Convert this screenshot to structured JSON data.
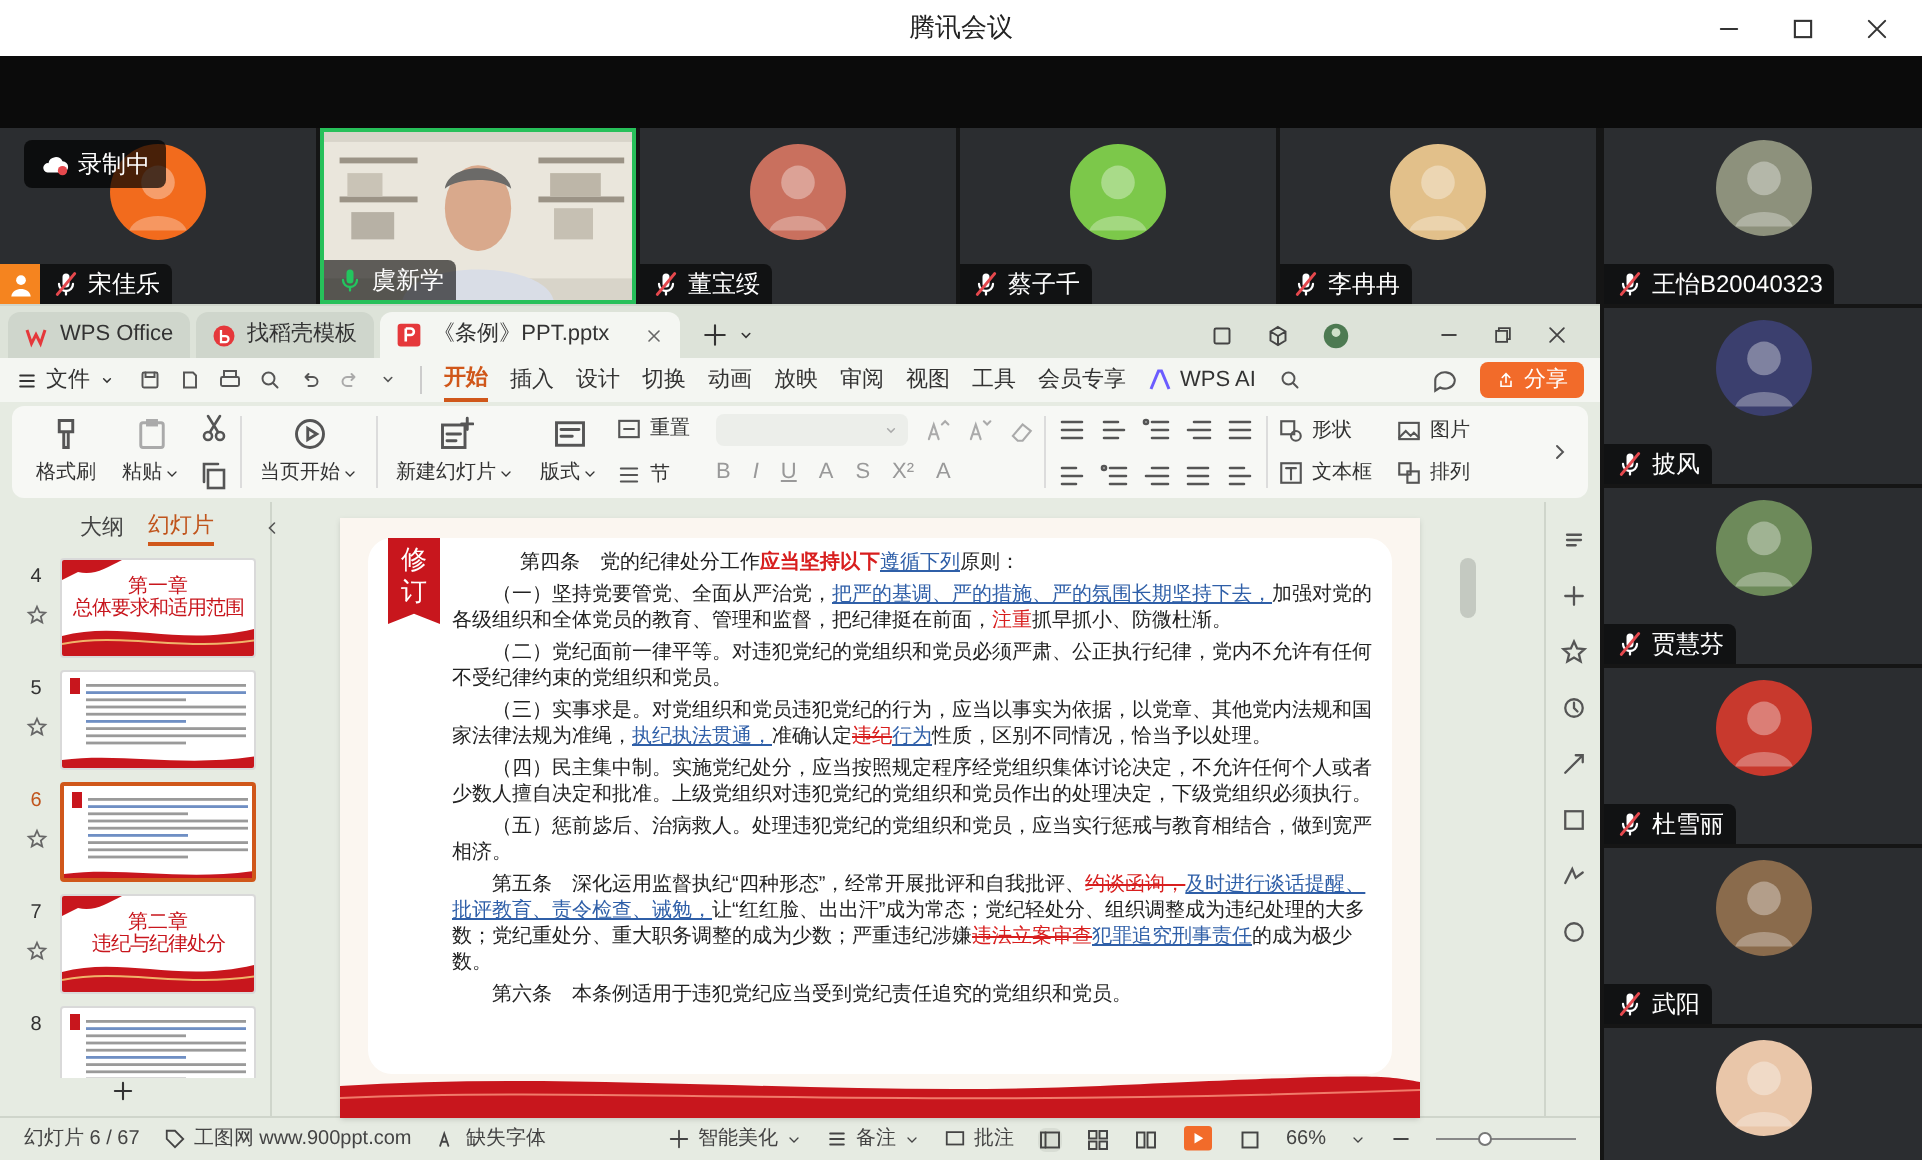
{
  "app_title": "腾讯会议",
  "recording": {
    "label": "录制中"
  },
  "top_participants": [
    {
      "name": "宋佳乐",
      "kind": "avatar",
      "color": "#f26b1d",
      "muted": true,
      "host": true,
      "speaking": false
    },
    {
      "name": "虞新学",
      "kind": "video",
      "muted": false,
      "host": false,
      "speaking": true
    },
    {
      "name": "董宝绥",
      "kind": "avatar",
      "color": "#c9705e",
      "muted": true,
      "host": false,
      "speaking": false
    },
    {
      "name": "蔡子千",
      "kind": "avatar",
      "color": "#7cc84a",
      "muted": true,
      "host": false,
      "speaking": false
    },
    {
      "name": "李冉冉",
      "kind": "avatar",
      "color": "#e2c08a",
      "muted": true,
      "host": false,
      "speaking": false
    }
  ],
  "side_participants": [
    {
      "name": "王怡B20040323",
      "color": "#8d917c",
      "muted": true
    },
    {
      "name": "披风",
      "color": "#3b3f6e",
      "muted": true
    },
    {
      "name": "贾慧芬",
      "color": "#6d8a5a",
      "muted": true
    },
    {
      "name": "杜雪丽",
      "color": "#c8392d",
      "muted": true
    },
    {
      "name": "武阳",
      "color": "#8a6b4c",
      "muted": true
    },
    {
      "color": "#e9c6a9"
    }
  ],
  "wps": {
    "tabs": [
      {
        "label": "WPS Office",
        "kind": "home",
        "selected": false
      },
      {
        "label": "找稻壳模板",
        "kind": "template",
        "selected": false
      },
      {
        "label": "《条例》PPT.pptx",
        "kind": "doc",
        "selected": true
      }
    ],
    "menu": {
      "file": "文件",
      "items": [
        {
          "label": "开始",
          "selected": true
        },
        {
          "label": "插入",
          "selected": false
        },
        {
          "label": "设计",
          "selected": false
        },
        {
          "label": "切换",
          "selected": false
        },
        {
          "label": "动画",
          "selected": false
        },
        {
          "label": "放映",
          "selected": false
        },
        {
          "label": "审阅",
          "selected": false
        },
        {
          "label": "视图",
          "selected": false
        },
        {
          "label": "工具",
          "selected": false
        },
        {
          "label": "会员专享",
          "selected": false
        }
      ],
      "ai": "WPS AI",
      "share": "分享"
    },
    "ribbon": {
      "format_painter": "格式刷",
      "paste": "粘贴",
      "start_show": "当页开始",
      "new_slide": "新建幻灯片",
      "layout": "版式",
      "reset": "重置",
      "section": "节",
      "format_glyphs": [
        "B",
        "I",
        "U",
        "A",
        "S",
        "X²",
        "A"
      ],
      "shape": "形状",
      "picture": "图片",
      "textbox": "文本框",
      "arrange": "排列"
    },
    "panel": {
      "tabs": [
        {
          "label": "大纲",
          "selected": false
        },
        {
          "label": "幻灯片",
          "selected": true
        }
      ],
      "slides": [
        {
          "number": "4",
          "kind": "title",
          "title": "第一章",
          "subtitle": "总体要求和适用范围",
          "star": true,
          "selected": false
        },
        {
          "number": "5",
          "kind": "text",
          "star": true,
          "selected": false
        },
        {
          "number": "6",
          "kind": "text",
          "star": true,
          "selected": true
        },
        {
          "number": "7",
          "kind": "title",
          "title": "第二章",
          "subtitle": "违纪与纪律处分",
          "star": true,
          "selected": false
        },
        {
          "number": "8",
          "kind": "text",
          "selected": false
        }
      ]
    },
    "slide": {
      "badge": "修订",
      "paragraphs": [
        [
          {
            "kind": "plain",
            "text": "第四条　党的纪律处分工作"
          },
          {
            "kind": "emphasis",
            "text": "应当坚持以下"
          },
          {
            "kind": "insert",
            "text": "遵循下列"
          },
          {
            "kind": "plain",
            "text": "原则："
          }
        ],
        [
          {
            "kind": "plain",
            "text": "（一）坚持党要管党、全面从严治党，"
          },
          {
            "kind": "insert",
            "text": "把严的基调、严的措施、严的氛围长期坚持下去，"
          },
          {
            "kind": "plain",
            "text": "加强对党的各级组织和全体党员的教育、管理和监督，把纪律挺在前面，"
          },
          {
            "kind": "highlight",
            "text": "注重"
          },
          {
            "kind": "plain",
            "text": "抓早抓小、防微杜渐。"
          }
        ],
        [
          {
            "kind": "plain",
            "text": "（二）党纪面前一律平等。对违犯党纪的党组织和党员必须严肃、公正执行纪律，党内不允许有任何不受纪律约束的党组织和党员。"
          }
        ],
        [
          {
            "kind": "plain",
            "text": "（三）实事求是。对党组织和党员违犯党纪的行为，应当以事实为依据，以党章、其他党内法规和国家法律法规为准绳，"
          },
          {
            "kind": "insert",
            "text": "执纪执法贯通，"
          },
          {
            "kind": "plain",
            "text": "准确认定"
          },
          {
            "kind": "delete",
            "text": "违纪"
          },
          {
            "kind": "insert",
            "text": "行为"
          },
          {
            "kind": "plain",
            "text": "性质，区别不同情况，恰当予以处理。"
          }
        ],
        [
          {
            "kind": "plain",
            "text": "（四）民主集中制。实施党纪处分，应当按照规定程序经党组织集体讨论决定，不允许任何个人或者少数人擅自决定和批准。上级党组织对违犯党纪的党组织和党员作出的处理决定，下级党组织必须执行。"
          }
        ],
        [
          {
            "kind": "plain",
            "text": "（五）惩前毖后、治病救人。处理违犯党纪的党组织和党员，应当实行惩戒与教育相结合，做到宽严相济。"
          }
        ],
        [
          {
            "kind": "plain",
            "text": "第五条　深化运用监督执纪“四种形态”，经常开展批评和自我批评、"
          },
          {
            "kind": "delete",
            "text": "约谈函询，"
          },
          {
            "kind": "insert",
            "text": "及时进行谈话提醒、批评教育、责令检查、诫勉，"
          },
          {
            "kind": "plain",
            "text": "让“红红脸、出出汗”成为常态；党纪轻处分、组织调整成为违纪处理的大多数；党纪重处分、重大职务调整的成为少数；严重违纪涉嫌"
          },
          {
            "kind": "delete",
            "text": "违法立案审查"
          },
          {
            "kind": "insert",
            "text": "犯罪追究刑事责任"
          },
          {
            "kind": "plain",
            "text": "的成为极少数。"
          }
        ],
        [
          {
            "kind": "plain",
            "text": "第六条　本条例适用于违犯党纪应当受到党纪责任追究的党组织和党员。"
          }
        ]
      ]
    },
    "status": {
      "slide_count": "幻灯片 6 / 67",
      "theme": "工图网 www.900ppt.com",
      "missing_font": "缺失字体",
      "beautify": "智能美化",
      "notes": "备注",
      "comments": "批注",
      "zoom": "66%",
      "level": 0.34
    }
  }
}
